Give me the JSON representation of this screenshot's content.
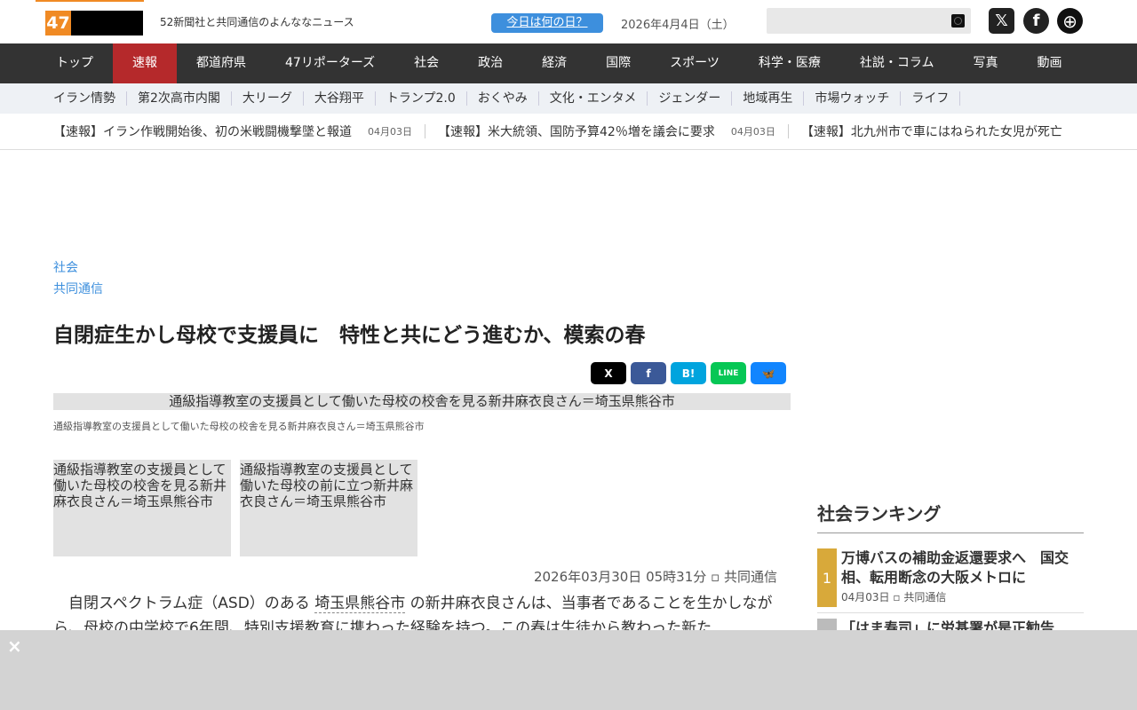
{
  "header": {
    "logo": "47",
    "tagline": "52新聞社と共同通信のよんななニュース",
    "today_button": "今日は何の日？",
    "date": "2026年4月4日（土）",
    "search_placeholder": ""
  },
  "nav": [
    "トップ",
    "速報",
    "都道府県",
    "47リポーターズ",
    "社会",
    "政治",
    "経済",
    "国際",
    "スポーツ",
    "科学・医療",
    "社説・コラム",
    "写真",
    "動画"
  ],
  "subnav": [
    "イラン情勢",
    "第2次高市内閣",
    "大リーグ",
    "大谷翔平",
    "トランプ2.0",
    "おくやみ",
    "文化・エンタメ",
    "ジェンダー",
    "地域再生",
    "市場ウォッチ",
    "ライフ"
  ],
  "ticker": [
    {
      "title": "【速報】イラン作戦開始後、初の米戦闘機撃墜と報道",
      "date": "04月03日"
    },
    {
      "title": "【速報】米大統領、国防予算42％増を議会に要求",
      "date": "04月03日"
    },
    {
      "title": "【速報】北九州市で車にはねられた女児が死亡"
    }
  ],
  "article": {
    "category": "社会",
    "source": "共同通信",
    "title": "自閉症生かし母校で支援員に　特性と共にどう進むか、模索の春",
    "main_image_alt": "通級指導教室の支援員として働いた母校の校舎を見る新井麻衣良さん＝埼玉県熊谷市",
    "caption": "通級指導教室の支援員として働いた母校の校舎を見る新井麻衣良さん＝埼玉県熊谷市",
    "thumbs": [
      "通級指導教室の支援員として働いた母校の校舎を見る新井麻衣良さん＝埼玉県熊谷市",
      "通級指導教室の支援員として働いた母校の前に立つ新井麻衣良さん＝埼玉県熊谷市"
    ],
    "datetime": "2026年03月30日 05時31分",
    "byline": "共同通信",
    "body_1": "自閉スペクトラム症（ASD）のある",
    "body_link": "埼玉県熊谷市",
    "body_2": "の新井麻衣良さんは、当事者であることを生かしながら、母校の中学校で6年間、特別支援教育に携わった経験を持つ。この春は生徒から教わった新た"
  },
  "share": [
    "X",
    "f",
    "B!",
    "LINE",
    "🦋"
  ],
  "sidebar": {
    "title": "社会ランキング",
    "items": [
      {
        "rank": "1",
        "title": "万博バスの補助金返還要求へ　国交相、転用断念の大阪メトロに",
        "date": "04月03日",
        "source": "共同通信"
      },
      {
        "rank": "",
        "title": "「はま寿司」に労基署が是正勧告"
      }
    ]
  },
  "overlay": {
    "close": "×"
  }
}
